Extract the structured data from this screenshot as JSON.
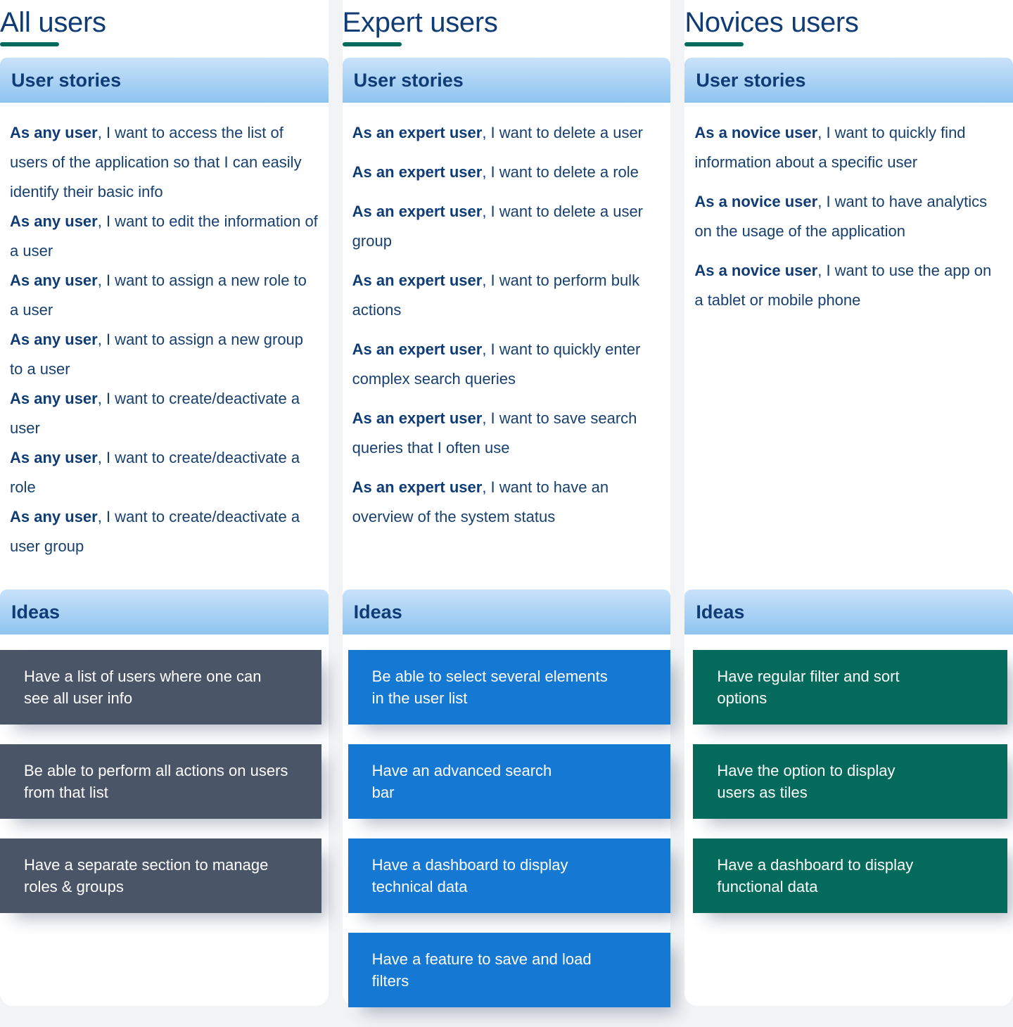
{
  "theme": {
    "title_color": "#0f3c75",
    "rule_color": "#046b5c",
    "band_top": "#c9e2fa",
    "band_bottom": "#8ec4f0",
    "story_text": "#17406e",
    "card_slate": "#4a5568",
    "card_blue": "#1578d3",
    "card_green": "#046b5c",
    "page_bg": "#f2f3f5",
    "panel_bg": "#ffffff"
  },
  "columns": [
    {
      "title": "All users",
      "stories_heading": "User stories",
      "ideas_heading": "Ideas",
      "card_style": "slate",
      "stories": [
        {
          "who": "As any user",
          "rest": ", I want to access the list of users of the application so that I can easily identify their basic info"
        },
        {
          "who": "As any user",
          "rest": ", I want to edit the information of a user"
        },
        {
          "who": "As any user",
          "rest": ", I want to assign a new role to a user"
        },
        {
          "who": "As any user",
          "rest": ", I want to assign a new group to a user"
        },
        {
          "who": "As any user",
          "rest": ", I want to create/deactivate a user"
        },
        {
          "who": "As any user",
          "rest": ", I want to create/deactivate a role"
        },
        {
          "who": "As any user",
          "rest": ", I want to create/deactivate a user group"
        }
      ],
      "ideas": [
        "Have a list of users where one can\nsee all user info",
        "Be able to perform all actions on users\nfrom that list",
        "Have a separate section to manage\nroles & groups"
      ]
    },
    {
      "title": "Expert users",
      "stories_heading": "User stories",
      "ideas_heading": "Ideas",
      "card_style": "blue",
      "stories": [
        {
          "who": "As an expert user",
          "rest": ", I want to delete a user"
        },
        {
          "who": "As an expert user",
          "rest": ", I want to delete a role"
        },
        {
          "who": "As an expert user",
          "rest": ", I want to delete a user group"
        },
        {
          "who": "As an expert user",
          "rest": ", I want to perform bulk actions"
        },
        {
          "who": "As an expert user",
          "rest": ", I want to quickly enter complex search queries"
        },
        {
          "who": "As an expert user",
          "rest": ", I want to save search queries that I often use"
        },
        {
          "who": "As an expert user",
          "rest": ", I want to have an overview of the system status"
        }
      ],
      "ideas": [
        "Be able to select several elements\nin the user list",
        "Have an advanced search\nbar",
        "Have a dashboard to display\ntechnical data",
        "Have a feature to save and load\nfilters"
      ]
    },
    {
      "title": "Novices users",
      "stories_heading": "User stories",
      "ideas_heading": "Ideas",
      "card_style": "green",
      "stories": [
        {
          "who": "As a novice user",
          "rest": ", I want to quickly find information about a specific user"
        },
        {
          "who": "As a novice user",
          "rest": ", I want to have analytics on the usage of the application"
        },
        {
          "who": "As a novice user",
          "rest": ", I want to use the app on a tablet or mobile phone"
        }
      ],
      "ideas": [
        "Have regular filter and sort\noptions",
        "Have the option to display\nusers as tiles",
        "Have a dashboard to display\nfunctional data"
      ]
    }
  ]
}
